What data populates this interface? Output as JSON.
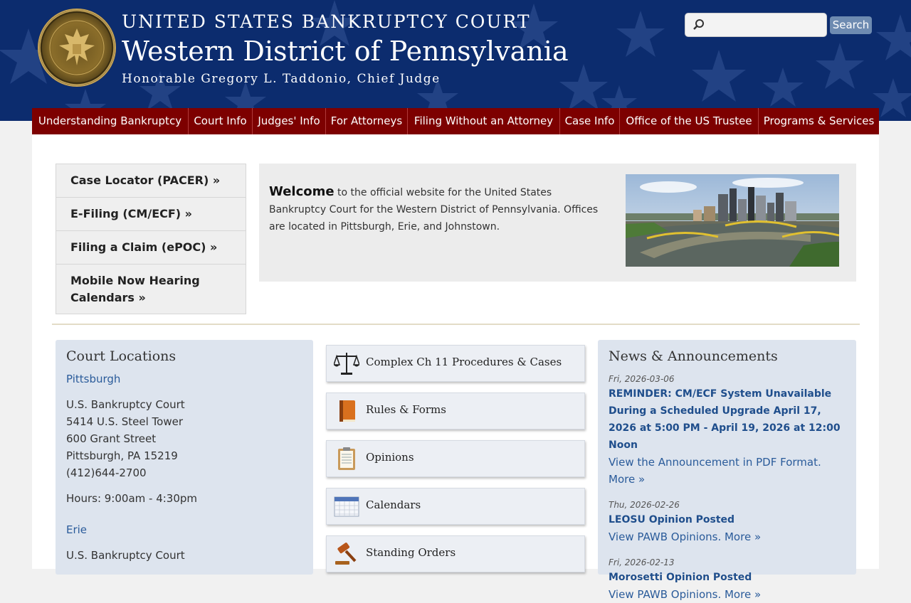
{
  "header": {
    "court": "UNITED STATES BANKRUPTCY COURT",
    "district": "Western District of Pennsylvania",
    "judge": "Honorable Gregory L. Taddonio, Chief Judge",
    "seal_text": "UNITED STATES BANKRUPTCY COURT · WESTERN DISTRICT OF PENNSYLVANIA",
    "search_placeholder": "",
    "search_button": "Search"
  },
  "nav": [
    {
      "label": "Understanding Bankruptcy"
    },
    {
      "label": "Court Info"
    },
    {
      "label": "Judges' Info"
    },
    {
      "label": "For Attorneys"
    },
    {
      "label": "Filing Without an Attorney"
    },
    {
      "label": "Case Info"
    },
    {
      "label": "Office of the US Trustee"
    },
    {
      "label": "Programs & Services"
    }
  ],
  "quick_links": [
    {
      "label": "Case Locator (PACER) »"
    },
    {
      "label": "E-Filing (CM/ECF) »"
    },
    {
      "label": "Filing a Claim (ePOC) »"
    },
    {
      "label": "Mobile Now Hearing Calendars »"
    }
  ],
  "welcome": {
    "lead": "Welcome",
    "text": " to the official website for the United States Bankruptcy Court for the Western District of Pennsylvania. Offices are located in Pittsburgh, Erie, and Johnstown."
  },
  "locations": {
    "title": "Court Locations",
    "pittsburgh": {
      "link": "Pittsburgh",
      "lines": [
        "U.S. Bankruptcy Court",
        "5414 U.S. Steel Tower",
        "600 Grant Street",
        "Pittsburgh, PA 15219",
        "(412)644-2700"
      ],
      "hours": "Hours: 9:00am - 4:30pm"
    },
    "erie": {
      "link": "Erie",
      "line1": "U.S. Bankruptcy Court"
    }
  },
  "tiles": [
    {
      "label": "Complex Ch 11 Procedures & Cases",
      "icon": "scales-icon"
    },
    {
      "label": "Rules & Forms",
      "icon": "book-icon"
    },
    {
      "label": "Opinions",
      "icon": "clipboard-icon"
    },
    {
      "label": "Calendars",
      "icon": "calendar-icon"
    },
    {
      "label": "Standing Orders",
      "icon": "gavel-icon"
    }
  ],
  "news": {
    "title": "News & Announcements",
    "items": [
      {
        "date": "Fri, 2026-03-06",
        "headline": "REMINDER: CM/ECF System Unavailable During a Scheduled Upgrade April 17, 2026 at 5:00 PM - April 19, 2026 at 12:00 Noon",
        "more": "View the Announcement in PDF Format. More »"
      },
      {
        "date": "Thu, 2026-02-26",
        "headline": "LEOSU Opinion Posted",
        "more": "View PAWB Opinions. More »"
      },
      {
        "date": "Fri, 2026-02-13",
        "headline": "Morosetti Opinion Posted",
        "more": "View PAWB Opinions. More »"
      }
    ]
  },
  "colors": {
    "header_bg": "#0c2c6e",
    "nav_bg": "#7d0000",
    "link": "#2a5b9a",
    "panel_bg": "#dde4ee"
  }
}
